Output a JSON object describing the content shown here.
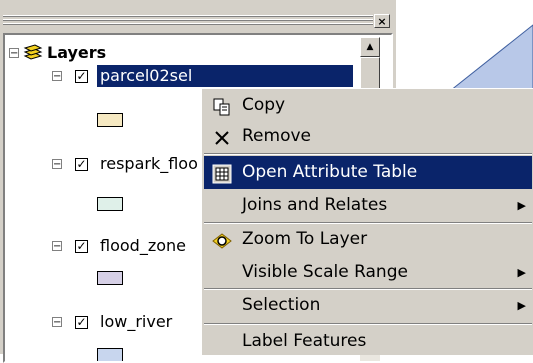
{
  "toc": {
    "close_glyph": "×",
    "root_label": "Layers",
    "layers": [
      {
        "label": "parcel02sel",
        "checked": true,
        "swatch_color": "#f6e9c2",
        "selected": true
      },
      {
        "label": "respark_floo",
        "checked": true,
        "swatch_color": "#dff0e9",
        "selected": false
      },
      {
        "label": "flood_zone",
        "checked": true,
        "swatch_color": "#d6d0e6",
        "selected": false
      },
      {
        "label": "low_river",
        "checked": true,
        "swatch_color": "#c8d6ee",
        "selected": false
      }
    ]
  },
  "menu": {
    "items": [
      {
        "label": "Copy",
        "icon": "copy-icon",
        "submenu": false
      },
      {
        "label": "Remove",
        "icon": "remove-x-icon",
        "submenu": false
      },
      {
        "label": "Open Attribute Table",
        "icon": "table-icon",
        "submenu": false,
        "highlighted": true
      },
      {
        "label": "Joins and Relates",
        "icon": "",
        "submenu": true
      },
      {
        "label": "Zoom To Layer",
        "icon": "zoom-to-layer-icon",
        "submenu": false
      },
      {
        "label": "Visible Scale Range",
        "icon": "",
        "submenu": true
      },
      {
        "label": "Selection",
        "icon": "",
        "submenu": true
      },
      {
        "label": "Label Features",
        "icon": "",
        "submenu": false
      }
    ]
  },
  "colors": {
    "highlight": "#0a246a",
    "map_polygon": "#b8c8e8",
    "map_outline": "#4060a0"
  }
}
